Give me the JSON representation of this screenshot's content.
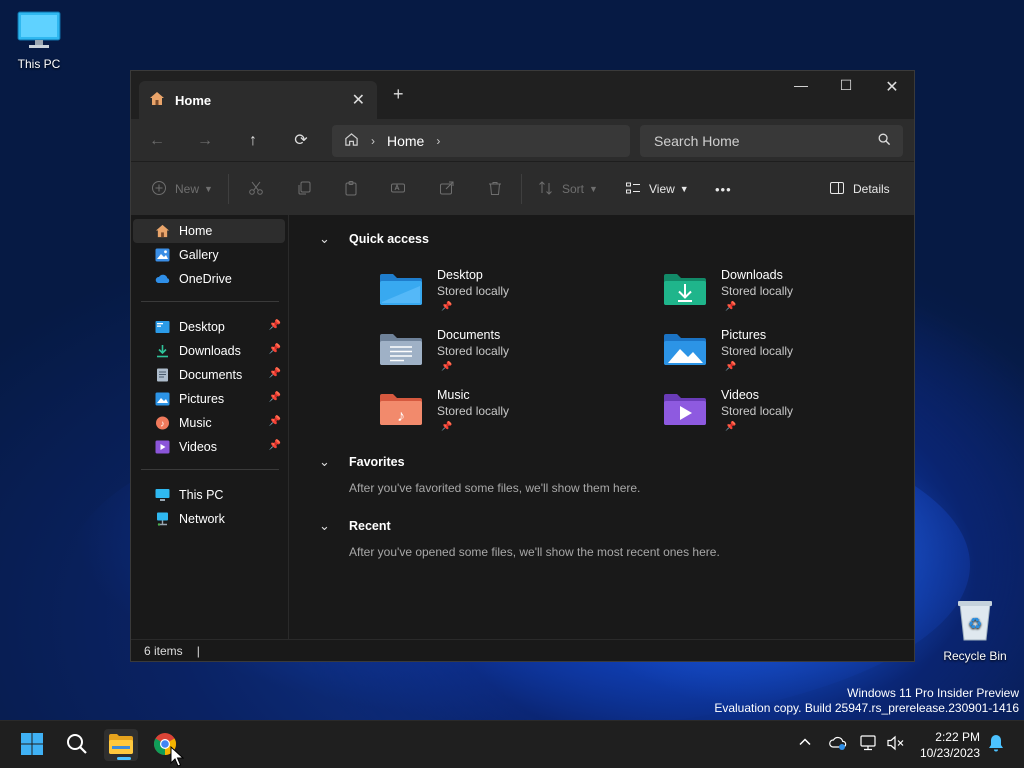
{
  "desktop": {
    "icons": [
      {
        "label": "This PC"
      },
      {
        "label": "Recycle Bin"
      }
    ],
    "watermark": {
      "line1": "Windows 11 Pro Insider Preview",
      "line2": "Evaluation copy. Build 25947.rs_prerelease.230901-1416"
    }
  },
  "window": {
    "tab": {
      "title": "Home",
      "close": "✕"
    },
    "new_tab": "+",
    "controls": {
      "minimize": "—",
      "maximize": "☐",
      "close": "✕"
    },
    "nav": {
      "back": "←",
      "forward": "→",
      "up": "↑",
      "refresh": "⟳"
    },
    "breadcrumb": {
      "items": [
        "Home"
      ],
      "separator": "›"
    },
    "search": {
      "placeholder": "Search Home"
    },
    "toolbar": {
      "new_label": "New",
      "sort_label": "Sort",
      "view_label": "View",
      "more": "•••",
      "details_label": "Details"
    },
    "sidebar": {
      "top": [
        {
          "label": "Home",
          "icon": "home-icon",
          "selected": true
        },
        {
          "label": "Gallery",
          "icon": "gallery-icon"
        },
        {
          "label": "OneDrive",
          "icon": "onedrive-icon"
        }
      ],
      "pinned": [
        {
          "label": "Desktop",
          "icon": "desktop-folder-icon"
        },
        {
          "label": "Downloads",
          "icon": "downloads-folder-icon"
        },
        {
          "label": "Documents",
          "icon": "documents-folder-icon"
        },
        {
          "label": "Pictures",
          "icon": "pictures-folder-icon"
        },
        {
          "label": "Music",
          "icon": "music-folder-icon"
        },
        {
          "label": "Videos",
          "icon": "videos-folder-icon"
        }
      ],
      "bottom": [
        {
          "label": "This PC",
          "icon": "this-pc-icon"
        },
        {
          "label": "Network",
          "icon": "network-icon"
        }
      ]
    },
    "quick_access": {
      "title": "Quick access",
      "items": [
        {
          "name": "Desktop",
          "status": "Stored locally",
          "color": "#2b9be8"
        },
        {
          "name": "Downloads",
          "status": "Stored locally",
          "color": "#1aa882"
        },
        {
          "name": "Documents",
          "status": "Stored locally",
          "color": "#8fa1b8"
        },
        {
          "name": "Pictures",
          "status": "Stored locally",
          "color": "#2c94e6"
        },
        {
          "name": "Music",
          "status": "Stored locally",
          "color": "#f07a5c"
        },
        {
          "name": "Videos",
          "status": "Stored locally",
          "color": "#8b55d9"
        }
      ]
    },
    "favorites": {
      "title": "Favorites",
      "message": "After you've favorited some files, we'll show them here."
    },
    "recent": {
      "title": "Recent",
      "message": "After you've opened some files, we'll show the most recent ones here."
    },
    "status": {
      "items": "6 items"
    }
  },
  "taskbar": {
    "clock": {
      "time": "2:22 PM",
      "date": "10/23/2023"
    }
  }
}
